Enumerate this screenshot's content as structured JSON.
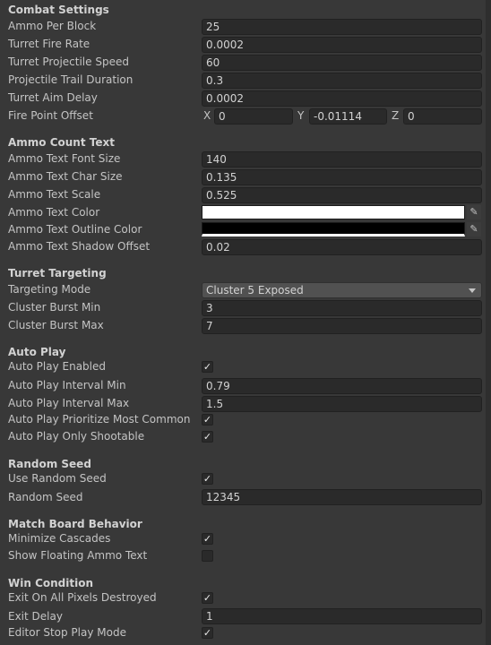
{
  "combat": {
    "header": "Combat Settings",
    "ammo_per_block": {
      "label": "Ammo Per Block",
      "value": "25"
    },
    "fire_rate": {
      "label": "Turret Fire Rate",
      "value": "0.0002"
    },
    "projectile_speed": {
      "label": "Turret Projectile Speed",
      "value": "60"
    },
    "trail_duration": {
      "label": "Projectile Trail Duration",
      "value": "0.3"
    },
    "aim_delay": {
      "label": "Turret Aim Delay",
      "value": "0.0002"
    },
    "fire_point": {
      "label": "Fire Point Offset",
      "x_label": "X",
      "x": "0",
      "y_label": "Y",
      "y": "-0.01114",
      "z_label": "Z",
      "z": "0"
    }
  },
  "ammo_text": {
    "header": "Ammo Count Text",
    "font_size": {
      "label": "Ammo Text Font Size",
      "value": "140"
    },
    "char_size": {
      "label": "Ammo Text Char Size",
      "value": "0.135"
    },
    "scale": {
      "label": "Ammo Text Scale",
      "value": "0.525"
    },
    "color": {
      "label": "Ammo Text Color",
      "value": "#ffffff"
    },
    "outline_color": {
      "label": "Ammo Text Outline Color",
      "value": "#000000"
    },
    "shadow_offset": {
      "label": "Ammo Text Shadow Offset",
      "value": "0.02"
    }
  },
  "targeting": {
    "header": "Turret Targeting",
    "mode": {
      "label": "Targeting Mode",
      "value": "Cluster 5 Exposed"
    },
    "burst_min": {
      "label": "Cluster Burst Min",
      "value": "3"
    },
    "burst_max": {
      "label": "Cluster Burst Max",
      "value": "7"
    }
  },
  "auto_play": {
    "header": "Auto Play",
    "enabled": {
      "label": "Auto Play Enabled",
      "checked": true
    },
    "interval_min": {
      "label": "Auto Play Interval Min",
      "value": "0.79"
    },
    "interval_max": {
      "label": "Auto Play Interval Max",
      "value": "1.5"
    },
    "prioritize": {
      "label": "Auto Play Prioritize Most Common",
      "checked": true
    },
    "only_shootable": {
      "label": "Auto Play Only Shootable",
      "checked": true
    }
  },
  "random_seed": {
    "header": "Random Seed",
    "use": {
      "label": "Use Random Seed",
      "checked": true
    },
    "seed": {
      "label": "Random Seed",
      "value": "12345"
    }
  },
  "match_board": {
    "header": "Match Board Behavior",
    "minimize": {
      "label": "Minimize Cascades",
      "checked": true
    },
    "floating": {
      "label": "Show Floating Ammo Text",
      "checked": false
    }
  },
  "win": {
    "header": "Win Condition",
    "exit_on_destroyed": {
      "label": "Exit On All Pixels Destroyed",
      "checked": true
    },
    "exit_delay": {
      "label": "Exit Delay",
      "value": "1"
    },
    "stop_play": {
      "label": "Editor Stop Play Mode",
      "checked": true
    }
  },
  "checkmark": "✓",
  "picker_glyph": "✎"
}
